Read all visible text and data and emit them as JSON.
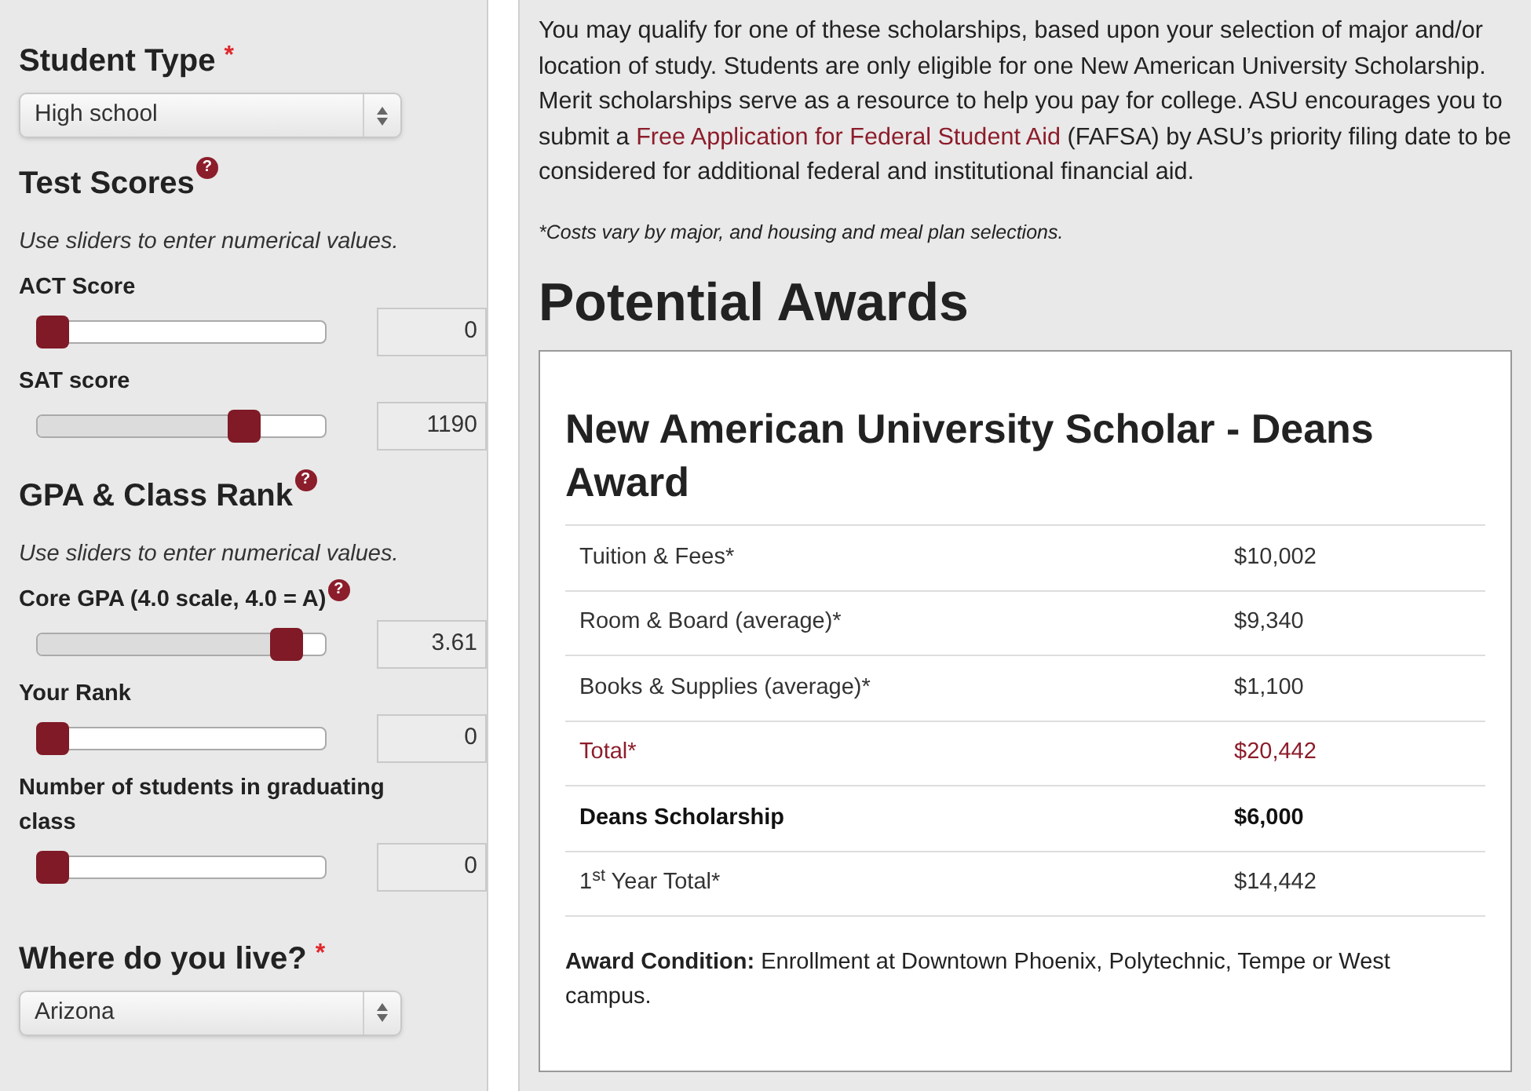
{
  "sidebar": {
    "student_type": {
      "title": "Student Type",
      "required": "*",
      "value": "High school"
    },
    "test_scores": {
      "title": "Test Scores",
      "help": "?",
      "hint": "Use sliders to enter numerical values.",
      "sliders": [
        {
          "label": "ACT Score",
          "level": 0,
          "value": "0"
        },
        {
          "label": "SAT score",
          "level": 0.74,
          "value": "1190"
        }
      ]
    },
    "gpa_rank": {
      "title": "GPA & Class Rank",
      "help": "?",
      "hint": "Use sliders to enter numerical values.",
      "sliders": [
        {
          "label": "Core GPA (4.0 scale, 4.0 = A)",
          "help": "?",
          "level": 0.91,
          "value": "3.61"
        },
        {
          "label": "Your Rank",
          "level": 0,
          "value": "0"
        },
        {
          "label": "Number of students in graduating class",
          "level": 0,
          "value": "0"
        }
      ]
    },
    "residence": {
      "title": "Where do you live?",
      "required": "*",
      "value": "Arizona"
    }
  },
  "main": {
    "intro": {
      "before": "You may qualify for one of these scholarships, based upon your selection of major and/or location of study. Students are only eligible for one New American University Scholarship. Merit scholarships serve as a resource to help you pay for college. ASU encourages you to submit a",
      "link": "Free Application for Federal Student Aid",
      "after": "(FAFSA) by ASU’s priority filing date to be considered for additional federal and institutional financial aid."
    },
    "note": "*Costs vary by major, and housing and meal plan selections.",
    "heading": "Potential Awards",
    "award": {
      "title": "New American University Scholar - Deans Award",
      "rows": [
        {
          "kind": "cost",
          "label": "Tuition & Fees*",
          "amount": "$10,002"
        },
        {
          "kind": "cost",
          "label": "Room & Board (average)*",
          "amount": "$9,340"
        },
        {
          "kind": "cost",
          "label": "Books & Supplies (average)*",
          "amount": "$1,100"
        },
        {
          "kind": "total",
          "label": "Total*",
          "amount": "$20,442"
        },
        {
          "kind": "scholarship",
          "label": "Deans Scholarship",
          "amount": "$6,000"
        },
        {
          "kind": "cost",
          "label": "1$^{st}$ Year Total*",
          "amount": "$14,442"
        }
      ],
      "condition": "**Award Condition:** Enrollment at Downtown Phoenix, Polytechnic, Tempe or West campus."
    }
  }
}
